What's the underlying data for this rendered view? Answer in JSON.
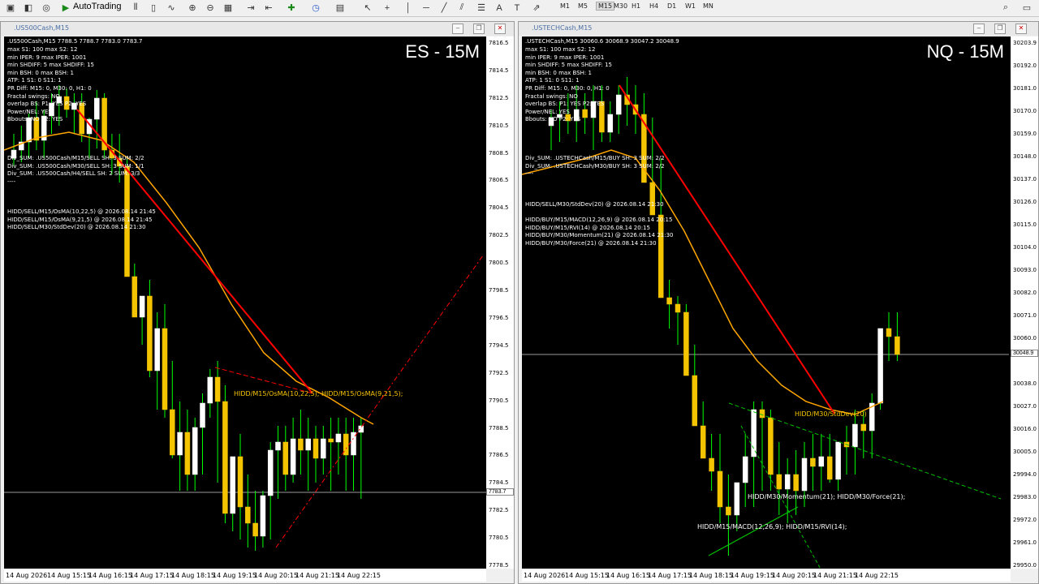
{
  "toolbar": {
    "autotrading_label": "AutoTrading",
    "timeframes": [
      "M1",
      "M5",
      "M15",
      "M30",
      "H1",
      "H4",
      "D1",
      "W1",
      "MN"
    ],
    "active_timeframe": "M15"
  },
  "left": {
    "window_title": ".US500Cash,M15",
    "header_line": ".US500Cash,M15  7788.5 7788.7 7783.0 7783.7",
    "big_label": "ES - 15M",
    "info_lines": [
      "max S1: 100 max S2: 12",
      "min IPER: 9 max IPER: 1001",
      "min SHDIFF: 5 max SHDIFF: 15",
      "min BSH: 0 max BSH: 1",
      "ATP: 1 S1: 0 S11: 1",
      "PR Diff: M15: 0, M30: 0, H1: 0",
      "Fractal swings:  NO",
      "overlap BS:  P1: YES P2: YES",
      "Power/NEL:  YES",
      "Bbouts:  NO  P2: YES"
    ],
    "div_lines": [
      "Div_SUM: .US500Cash/M15/SELL SH: 3 SUM: 2/2",
      "Div_SUM: .US500Cash/M30/SELL SH: 3 SUM: 1/1",
      "Div_SUM: .US500Cash/H4/SELL SH: 2 SUM: 3/3",
      "----"
    ],
    "hidd_lines": [
      "HIDD/SELL/M15/OsMA(10,22,5) @ 2026.08.14 21:45",
      "HIDD/SELL/M15/OsMA(9,21,5) @ 2026.08.14 21:45",
      "HIDD/SELL/M30/StdDev(20) @ 2026.08.14 21:30"
    ],
    "annotation": "HIDD/M15/OsMA(10,22,5); HIDD/M15/OsMA(9,21,5);",
    "price_labels": [
      "7816.5",
      "7814.5",
      "7812.5",
      "7810.5",
      "7808.5",
      "7806.5",
      "7804.5",
      "7802.5",
      "7800.5",
      "7798.5",
      "7796.5",
      "7794.5",
      "7792.5",
      "7790.5",
      "7788.5",
      "7786.5",
      "7784.5",
      "7782.5",
      "7780.5",
      "7778.5"
    ],
    "current_price": "7783.7",
    "time_labels": [
      "14 Aug 2026",
      "14 Aug 15:15",
      "14 Aug 16:15",
      "14 Aug 17:15",
      "14 Aug 18:15",
      "14 Aug 19:15",
      "14 Aug 20:15",
      "14 Aug 21:15",
      "14 Aug 22:15"
    ]
  },
  "right": {
    "window_title": ".USTECHCash,M15",
    "header_line": ".USTECHCash,M15  30060.6 30068.9 30047.2 30048.9",
    "big_label": "NQ - 15M",
    "info_lines": [
      "max S1: 100 max S2: 12",
      "min IPER: 9 max IPER: 1001",
      "min SHDIFF: 5 max SHDIFF: 15",
      "min BSH: 0 max BSH: 1",
      "ATP: 1 S1: 0 S11: 1",
      "PR Diff: M15: 0, M30: 0, H1: 0",
      "Fractal swings:  NO",
      "overlap BS:  P1: YES P2: YES",
      "Power/NEL:  YES",
      "Bbouts:  NO  P2: YES"
    ],
    "div_lines": [
      "Div_SUM: .USTECHCash/M15/BUY SH: 3 SUM: 2/2",
      "Div_SUM: .USTECHCash/M30/BUY SH: 3 SUM: 2/2",
      "----"
    ],
    "hidd_lines": [
      "HIDD/SELL/M30/StdDev(20) @ 2026.08.14 21:30",
      "",
      "HIDD/BUY/M15/MACD(12,26,9) @ 2026.08.14 20:15",
      "HIDD/BUY/M15/RVI(14) @ 2026.08.14 20:15",
      "HIDD/BUY/M30/Momentum(21) @ 2026.08.14 21:30",
      "HIDD/BUY/M30/Force(21) @ 2026.08.14 21:30"
    ],
    "annotation_stddev": "HIDD/M30/StdDev(20)",
    "annotation_momentum": "HIDD/M30/Momentum(21); HIDD/M30/Force(21);",
    "annotation_macd": "HIDD/M15/MACD(12,26,9); HIDD/M15/RVI(14);",
    "price_labels": [
      "30203.9",
      "30192.0",
      "30181.0",
      "30170.0",
      "30159.0",
      "30148.0",
      "30137.0",
      "30126.0",
      "30115.0",
      "30104.0",
      "30093.0",
      "30082.0",
      "30071.0",
      "30060.0",
      "30048.9",
      "30038.0",
      "30027.0",
      "30016.0",
      "30005.0",
      "29994.0",
      "29983.0",
      "29972.0",
      "29961.0",
      "29950.0"
    ],
    "current_price": "30048.9",
    "time_labels": [
      "14 Aug 2026",
      "14 Aug 15:15",
      "14 Aug 16:15",
      "14 Aug 17:15",
      "14 Aug 18:15",
      "14 Aug 19:15",
      "14 Aug 20:15",
      "14 Aug 21:15",
      "14 Aug 22:15"
    ]
  },
  "colors": {
    "bull_body": "#ffffff",
    "bear_body": "#f5c400",
    "wick": "#00ff00",
    "ema": "#ffa500",
    "trend": "#ff0000"
  }
}
